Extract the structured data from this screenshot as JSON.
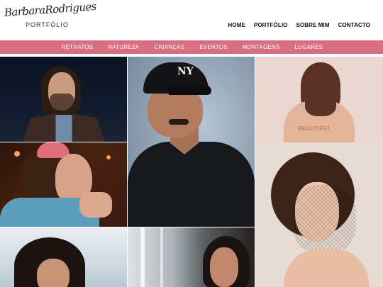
{
  "logo": {
    "script": "BarbaraRodrigues",
    "subtitle": "PORTFÓLIO"
  },
  "topnav": [
    "HOME",
    "PORTFÓLIO",
    "SOBRE MIM",
    "CONTACTO"
  ],
  "categories": [
    "RETRATOS",
    "NATUREZA",
    "CRIANÇAS",
    "EVENTOS",
    "MONTAGENS",
    "LUGARES"
  ],
  "gallery": [
    {
      "name": "man-long-hair-portrait"
    },
    {
      "name": "man-ny-cap-portrait",
      "cap_text": "NY"
    },
    {
      "name": "woman-back-tattoo",
      "tattoo_text": "BEAUTIFUL"
    },
    {
      "name": "woman-curly-hair-bandana"
    },
    {
      "name": "woman-veil-portrait"
    },
    {
      "name": "child-dark-hair"
    },
    {
      "name": "woman-window-portrait"
    }
  ],
  "colors": {
    "accent": "#d86e7f",
    "text": "#111111"
  }
}
